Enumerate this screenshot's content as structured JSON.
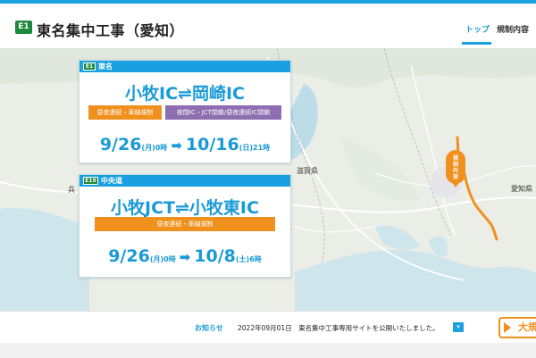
{
  "header": {
    "badge": "E1",
    "title": "東名集中工事（愛知）",
    "nav": [
      {
        "label": "トップ",
        "active": true
      },
      {
        "label": "規制内容",
        "active": false
      }
    ]
  },
  "map": {
    "labels": [
      {
        "text": "滋賀県"
      },
      {
        "text": "愛知県"
      },
      {
        "text": "兵"
      }
    ],
    "pin_label": "規制内容",
    "route_color": "#f0901d"
  },
  "cards": [
    {
      "badge": "E1",
      "road": "東名",
      "section": "小牧IC⇌岡崎IC",
      "tags": [
        {
          "label": "昼夜連続・車線規制",
          "color": "orange"
        },
        {
          "label": "夜間IC・JCT閉鎖/昼夜連続IC閉鎖",
          "color": "purple"
        }
      ],
      "start_date": "9/26",
      "start_dow": "(月)",
      "start_time": "0時",
      "end_date": "10/16",
      "end_dow": "(日)",
      "end_time": "21時"
    },
    {
      "badge": "E19",
      "road": "中央道",
      "section": "小牧JCT⇌小牧東IC",
      "tags": [
        {
          "label": "昼夜連続・車線規制",
          "color": "orange"
        }
      ],
      "start_date": "9/26",
      "start_dow": "(月)",
      "start_time": "0時",
      "end_date": "10/8",
      "end_dow": "(土)",
      "end_time": "6時"
    }
  ],
  "news": {
    "label": "お知らせ",
    "text": "2022年09月01日　東名集中工事専用サイトを公開いたしました。",
    "toggle": "▾"
  },
  "bigmap_label": "大規",
  "colors": {
    "accent": "#1aa0e0",
    "orange": "#f0901d",
    "purple": "#8e6db0",
    "green": "#1c8a3c"
  }
}
